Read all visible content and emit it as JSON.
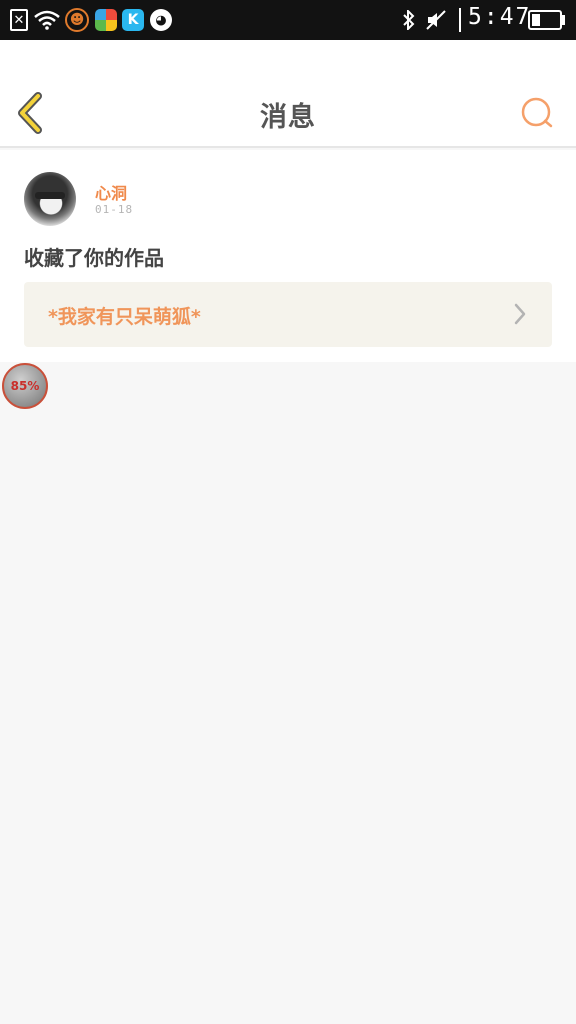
{
  "status_bar": {
    "time": "5:47",
    "battery_level": 0.3,
    "icons": [
      "close-icon",
      "wifi-icon",
      "smiley-app-icon",
      "pie-app-icon",
      "k-app-icon",
      "cat-app-icon",
      "bluetooth-icon",
      "mute-icon",
      "battery-icon"
    ]
  },
  "header": {
    "title": "消息",
    "back_icon": "back-chevron-icon",
    "search_icon": "search-icon",
    "accent_color": "#f08a4c"
  },
  "messages": [
    {
      "username": "心洞",
      "time": "01-18",
      "action": "收藏了你的作品",
      "work_title": "*我家有只呆萌狐*"
    }
  ],
  "overlay": {
    "progress_label": "85%"
  }
}
